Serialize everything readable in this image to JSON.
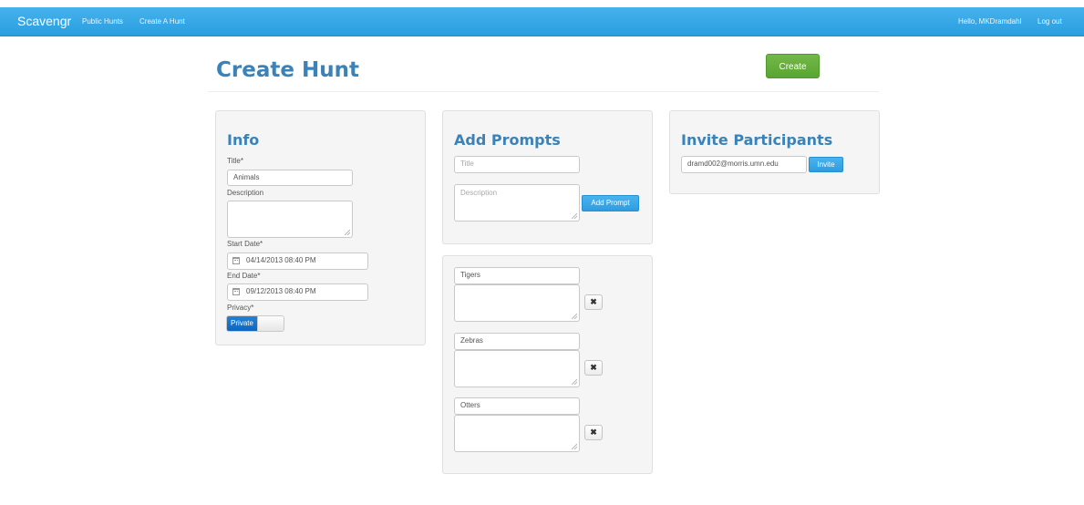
{
  "navbar": {
    "brand": "Scavengr",
    "links": [
      "Public Hunts",
      "Create A Hunt"
    ],
    "greeting": "Hello, MKDramdahl",
    "logout": "Log out"
  },
  "page": {
    "title": "Create Hunt",
    "create_button": "Create"
  },
  "info": {
    "heading": "Info",
    "title_label": "Title*",
    "title_value": "Animals",
    "description_label": "Description",
    "description_value": "",
    "start_label": "Start Date*",
    "start_value": "04/14/2013 08:40 PM",
    "end_label": "End Date*",
    "end_value": "09/12/2013 08:40 PM",
    "privacy_label": "Privacy*",
    "privacy_value": "Private"
  },
  "add_prompts": {
    "heading": "Add Prompts",
    "title_placeholder": "Title",
    "description_placeholder": "Description",
    "add_button": "Add Prompt"
  },
  "prompts": [
    {
      "title": "Tigers",
      "description": "",
      "remove": "✖"
    },
    {
      "title": "Zebras",
      "description": "",
      "remove": "✖"
    },
    {
      "title": "Otters",
      "description": "",
      "remove": "✖"
    }
  ],
  "invite": {
    "heading": "Invite Participants",
    "email_value": "dramd002@morris.umn.edu",
    "invite_button": "Invite"
  },
  "icons": {
    "calendar": "calendar-icon",
    "remove": "close-icon"
  },
  "colors": {
    "navbar": "#2a9ee0",
    "heading": "#3a82b8",
    "create_button": "#5aa532",
    "toggle_on": "#0d66c0"
  }
}
